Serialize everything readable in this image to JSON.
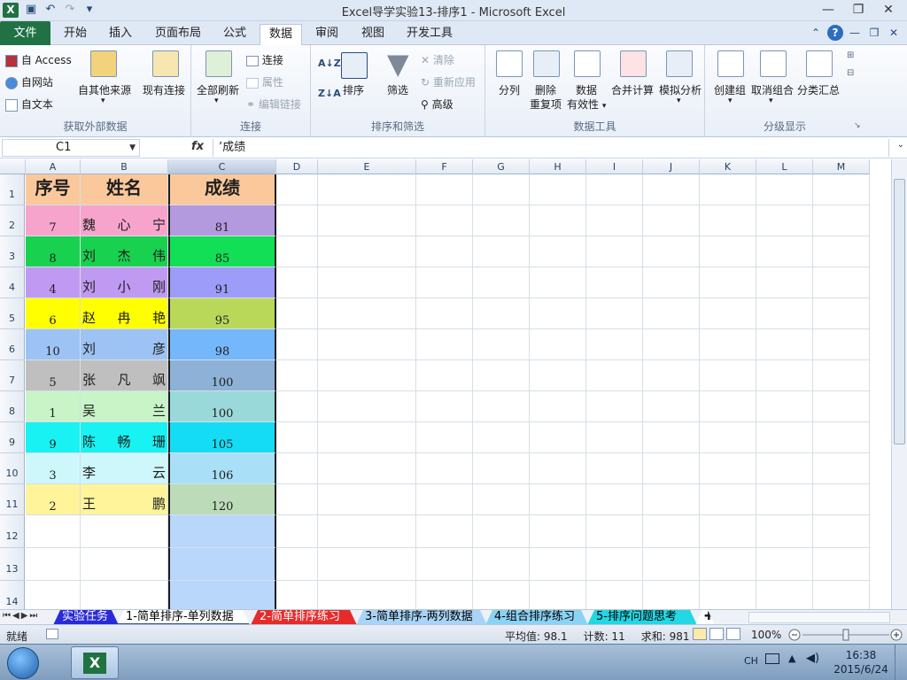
{
  "window": {
    "title": "Excel导学实验13-排序1  -  Microsoft Excel",
    "app_icon": "X"
  },
  "tabs": [
    "文件",
    "开始",
    "插入",
    "页面布局",
    "公式",
    "数据",
    "审阅",
    "视图",
    "开发工具"
  ],
  "ribbon": {
    "get_external": {
      "access": "自 Access",
      "web": "自网站",
      "text": "自文本",
      "other": "自其他来源",
      "label": "获取外部数据"
    },
    "existing": "现有连接",
    "connections": {
      "refresh": "全部刷新",
      "conn": "连接",
      "props": "属性",
      "edit": "编辑链接",
      "label": "连接"
    },
    "sort_filter": {
      "sort": "排序",
      "filter": "筛选",
      "clear": "清除",
      "reapply": "重新应用",
      "advanced": "高级",
      "label": "排序和筛选",
      "az": "A↓Z",
      "za": "Z↓A"
    },
    "data_tools": {
      "split": "分列",
      "remove_dup_1": "删除",
      "remove_dup_2": "重复项",
      "valid_1": "数据",
      "valid_2": "有效性",
      "consolidate": "合并计算",
      "whatif": "模拟分析",
      "label": "数据工具"
    },
    "outline": {
      "group": "创建组",
      "ungroup": "取消组合",
      "subtotal": "分类汇总",
      "label": "分级显示"
    }
  },
  "formula": {
    "namebox": "C1",
    "fx": "fx",
    "content": "’成绩"
  },
  "columns": [
    "A",
    "B",
    "C",
    "D",
    "E",
    "F",
    "G",
    "H",
    "I",
    "J",
    "K",
    "L",
    "M"
  ],
  "rows": [
    "1",
    "2",
    "3",
    "4",
    "5",
    "6",
    "7",
    "8",
    "9",
    "10",
    "11",
    "12",
    "13",
    "14"
  ],
  "header": {
    "seq": "序号",
    "name": "姓名",
    "score": "成绩"
  },
  "records": [
    {
      "seq": "7",
      "name": [
        "魏",
        "心",
        "宁"
      ],
      "score": "81"
    },
    {
      "seq": "8",
      "name": [
        "刘",
        "杰",
        "伟"
      ],
      "score": "85"
    },
    {
      "seq": "4",
      "name": [
        "刘",
        "小",
        "刚"
      ],
      "score": "91"
    },
    {
      "seq": "6",
      "name": [
        "赵",
        "冉",
        "艳"
      ],
      "score": "95"
    },
    {
      "seq": "10",
      "name": [
        "刘",
        "",
        "彦"
      ],
      "score": "98"
    },
    {
      "seq": "5",
      "name": [
        "张",
        "凡",
        "飒"
      ],
      "score": "100"
    },
    {
      "seq": "1",
      "name": [
        "吴",
        "",
        "兰"
      ],
      "score": "100"
    },
    {
      "seq": "9",
      "name": [
        "陈",
        "畅",
        "珊"
      ],
      "score": "105"
    },
    {
      "seq": "3",
      "name": [
        "李",
        "",
        "云"
      ],
      "score": "106"
    },
    {
      "seq": "2",
      "name": [
        "王",
        "",
        "鹏"
      ],
      "score": "120"
    }
  ],
  "colors": {
    "header": "#fbc89b",
    "ab": [
      "#f7a4cc",
      "#18d14f",
      "#c09af2",
      "#ffff00",
      "#9cc3f4",
      "#bfbfbf",
      "#c8f4c8",
      "#18f2f2",
      "#cdf7fb",
      "#fff49a"
    ],
    "c": [
      "#b39adf",
      "#12df55",
      "#9d9cf8",
      "#b9d85a",
      "#75b7fb",
      "#8eb1d7",
      "#9ad9d9",
      "#15dcf5",
      "#a9e0f7",
      "#bcdcb9"
    ],
    "c_empty": "#b8d7fb"
  },
  "sheets": [
    {
      "label": "实验任务",
      "bg": "#2a2bd8",
      "fg": "#ffffff"
    },
    {
      "label": "1-简单排序-单列数据",
      "bg": "#ffffff",
      "fg": "#000000"
    },
    {
      "label": "2-简单排序练习",
      "bg": "#e62b2b",
      "fg": "#ffffff"
    },
    {
      "label": "3-简单排序-两列数据",
      "bg": "#a9d4f6",
      "fg": "#000000"
    },
    {
      "label": "4-组合排序练习",
      "bg": "#8bd2f3",
      "fg": "#000000"
    },
    {
      "label": "5-排序问题思考",
      "bg": "#23d7e3",
      "fg": "#000000"
    }
  ],
  "status": {
    "ready": "就绪",
    "avg": "平均值: 98.1",
    "count": "计数: 11",
    "sum": "求和: 981",
    "zoom": "100%"
  },
  "taskbar": {
    "lang": "CH",
    "time": "16:38",
    "date": "2015/6/24"
  }
}
